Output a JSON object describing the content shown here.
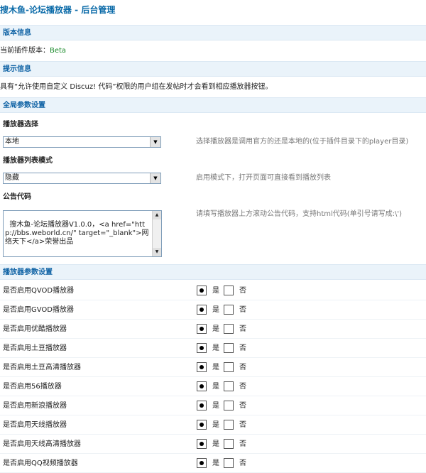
{
  "page_title": "搜木鱼-论坛播放器 - 后台管理",
  "sections": {
    "version": "版本信息",
    "tips": "提示信息",
    "global": "全局参数设置",
    "players": "播放器参数设置"
  },
  "version_info": {
    "label": "当前插件版本：",
    "value": "Beta"
  },
  "tip_text": "具有“允许使用自定义 Discuz! 代码”权限的用户组在发帖时才会看到相应播放器按钮。",
  "global_settings": {
    "player_select": {
      "label": "播放器选择",
      "value": "本地",
      "hint": "选择播放器是调用官方的还是本地的(位于插件目录下的player目录)"
    },
    "list_mode": {
      "label": "播放器列表模式",
      "value": "隐藏",
      "hint": "启用模式下，打开页面可直接看到播放列表"
    },
    "notice_code": {
      "label": "公告代码",
      "value": "搜木鱼-论坛播放器V1.0.0，<a href=\"http://bbs.weborld.cn/\" target=\"_blank\">网络天下</a>荣誉出品",
      "hint": "请填写播放器上方滚动公告代码，支持html代码(单引号请写成:\\')"
    }
  },
  "radio_labels": {
    "yes": "是",
    "no": "否"
  },
  "player_options": [
    {
      "label": "是否启用QVOD播放器",
      "enabled": true
    },
    {
      "label": "是否启用GVOD播放器",
      "enabled": true
    },
    {
      "label": "是否启用优酷播放器",
      "enabled": true
    },
    {
      "label": "是否启用土豆播放器",
      "enabled": true
    },
    {
      "label": "是否启用土豆高清播放器",
      "enabled": true
    },
    {
      "label": "是否启用56播放器",
      "enabled": true
    },
    {
      "label": "是否启用新浪播放器",
      "enabled": true
    },
    {
      "label": "是否启用天线播放器",
      "enabled": true
    },
    {
      "label": "是否启用天线高清播放器",
      "enabled": true
    },
    {
      "label": "是否启用QQ视频播放器",
      "enabled": true
    }
  ]
}
